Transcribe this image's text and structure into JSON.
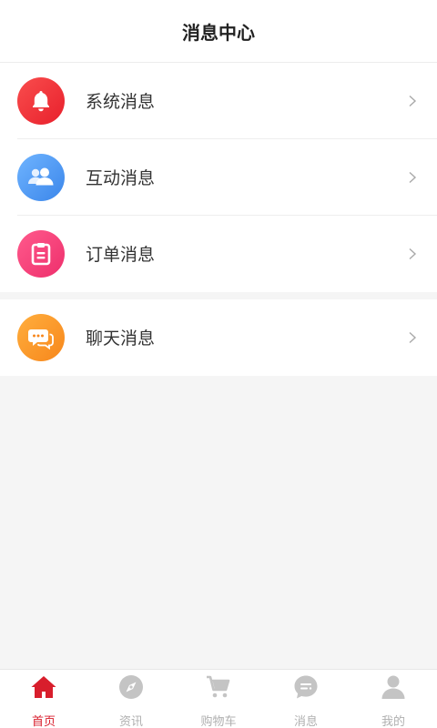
{
  "header": {
    "title": "消息中心"
  },
  "groups": [
    {
      "items": [
        {
          "label": "系统消息",
          "icon": "bell-icon",
          "color": "#f0373c"
        },
        {
          "label": "互动消息",
          "icon": "users-icon",
          "color": "#4f98f4"
        },
        {
          "label": "订单消息",
          "icon": "clipboard-icon",
          "color": "#f4457b"
        }
      ]
    },
    {
      "items": [
        {
          "label": "聊天消息",
          "icon": "chat-bubbles-icon",
          "color": "#fa9b2c"
        }
      ]
    }
  ],
  "tabbar": {
    "active_index": 0,
    "active_color": "#d81e2c",
    "inactive_color": "#b0b0b0",
    "tabs": [
      {
        "label": "首页",
        "icon": "home-icon"
      },
      {
        "label": "资讯",
        "icon": "compass-icon"
      },
      {
        "label": "购物车",
        "icon": "cart-icon"
      },
      {
        "label": "消息",
        "icon": "message-icon"
      },
      {
        "label": "我的",
        "icon": "user-icon"
      }
    ]
  }
}
